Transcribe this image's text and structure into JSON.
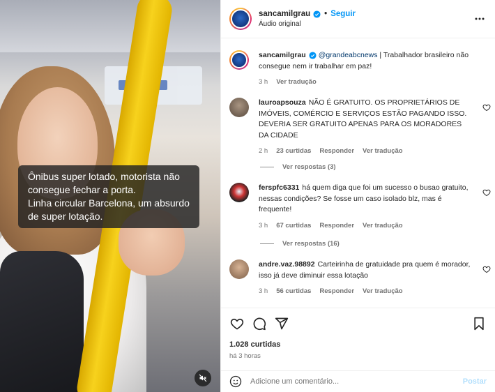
{
  "video": {
    "caption_lines": [
      "Ônibus super lotado, motorista não",
      "consegue fechar a porta.",
      "Linha circular Barcelona, um absurdo",
      "de super lotação."
    ],
    "mute_icon": "speaker-muted-icon"
  },
  "header": {
    "username": "sancamilgrau",
    "follow_label": "Seguir",
    "audio_label": "Áudio original"
  },
  "caption_post": {
    "username": "sancamilgrau",
    "mention": "@grandeabcnews",
    "text": " | Trabalhador brasileiro não consegue nem ir trabalhar em paz!",
    "time": "3 h",
    "translate": "Ver tradução"
  },
  "comments": [
    {
      "username": "lauroapsouza",
      "text": "NÃO É GRATUITO. OS PROPRIETÁRIOS DE IMÓVEIS, COMÉRCIO E SERVIÇOS ESTÃO PAGANDO ISSO. DEVERIA SER GRATUITO APENAS PARA OS MORADORES DA CIDADE",
      "time": "2 h",
      "likes": "23 curtidas",
      "reply": "Responder",
      "translate": "Ver tradução",
      "replies": "Ver respostas (3)"
    },
    {
      "username": "ferspfc6331",
      "text": "há quem diga que foi um sucesso o busao gratuito, nessas condições? Se fosse um caso isolado blz, mas é frequente!",
      "time": "3 h",
      "likes": "67 curtidas",
      "reply": "Responder",
      "translate": "Ver tradução",
      "replies": "Ver respostas (16)"
    },
    {
      "username": "andre.vaz.98892",
      "text": "Carteirinha de gratuidade pra quem é morador, isso já deve diminuir essa lotação",
      "time": "3 h",
      "likes": "56 curtidas",
      "reply": "Responder",
      "translate": "Ver tradução"
    }
  ],
  "actions": {
    "likes": "1.028 curtidas",
    "time": "há 3 horas"
  },
  "add_comment": {
    "placeholder": "Adicione um comentário...",
    "post_label": "Postar"
  },
  "colors": {
    "accent": "#0095f6",
    "post_disabled": "#b2dffc",
    "muted_text": "#737373",
    "pole_yellow": "#f7d21d"
  }
}
